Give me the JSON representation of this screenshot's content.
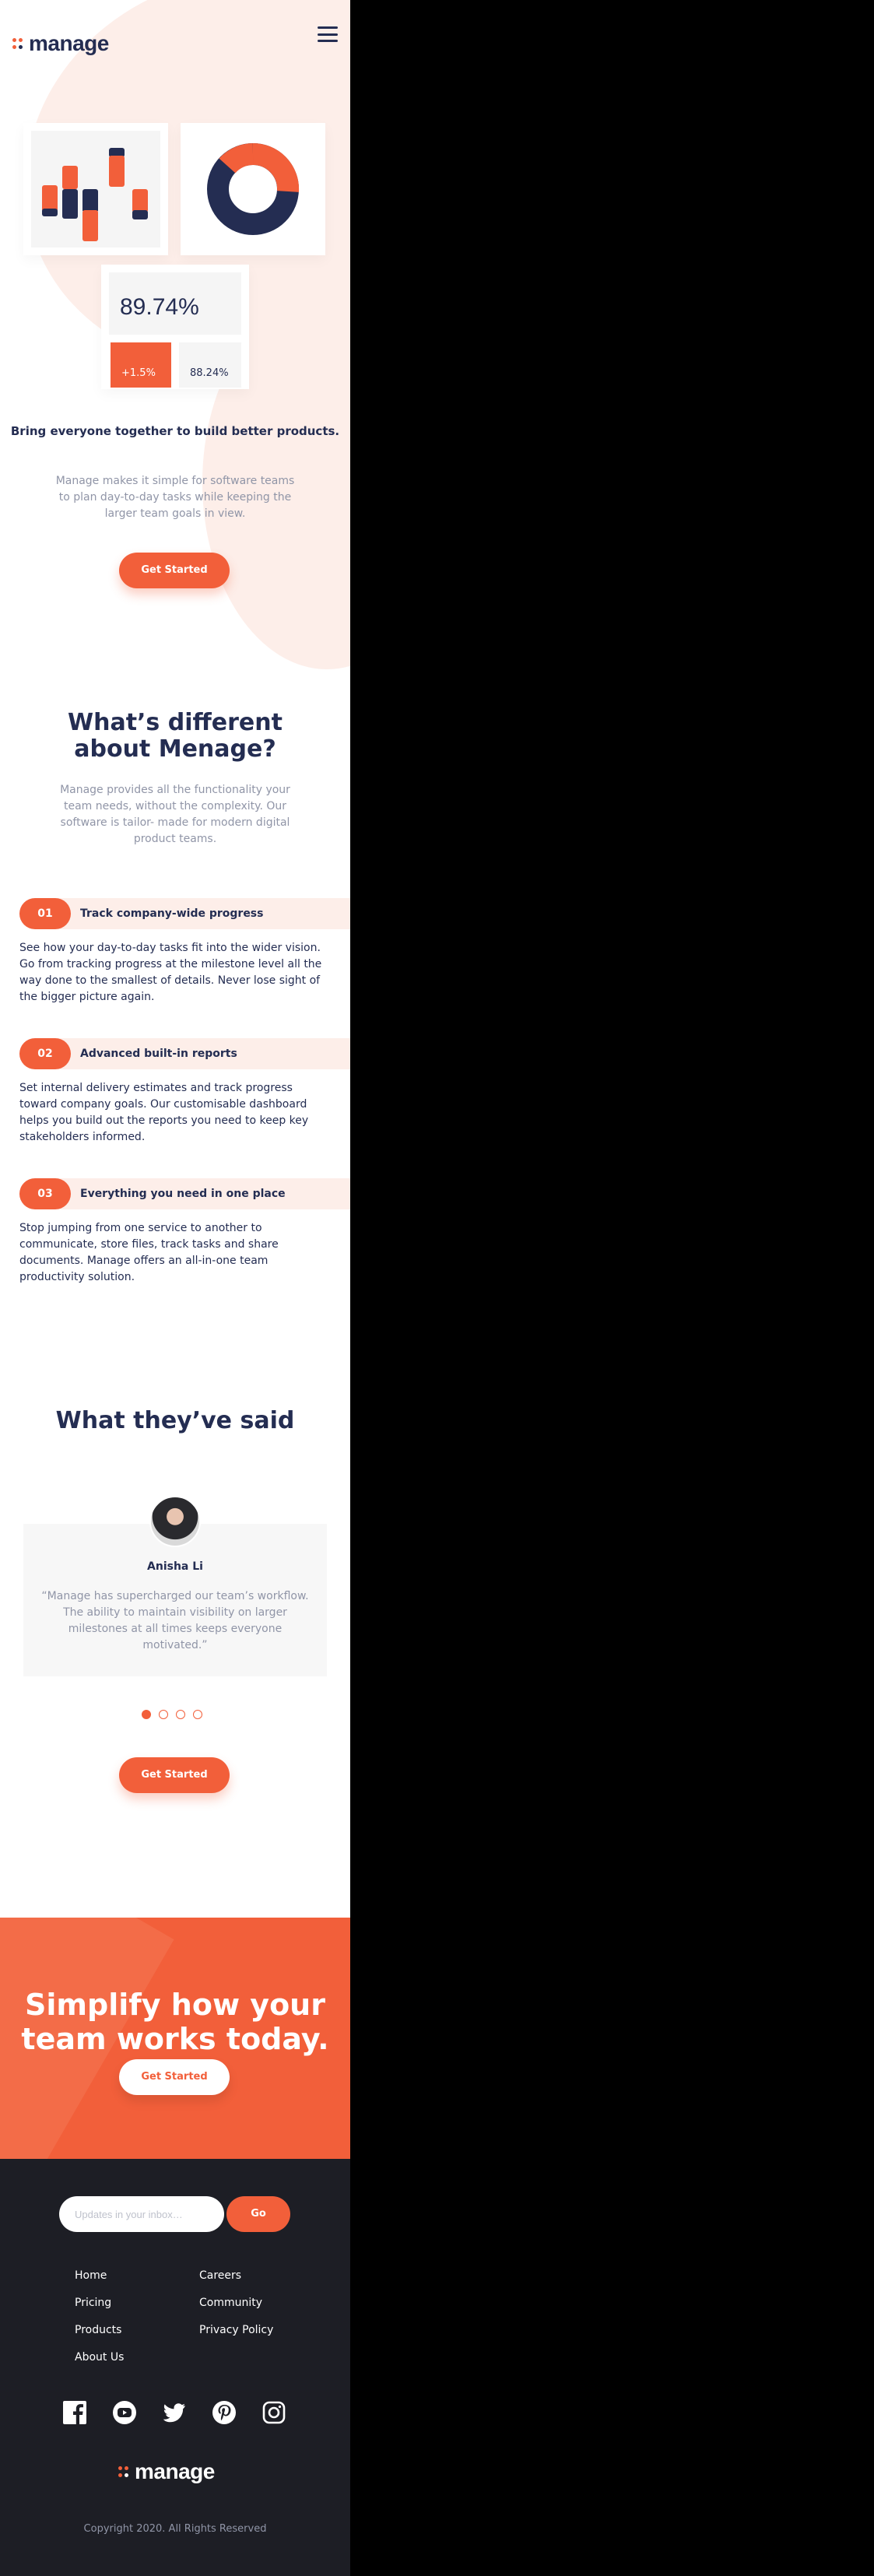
{
  "header": {
    "logo_text": "manage",
    "menu_icon": "hamburger-icon"
  },
  "hero": {
    "stat_main": "89.74%",
    "stat_change": "+1.5%",
    "stat_secondary": "88.24%",
    "title": "Bring everyone together to build better products.",
    "description": "Manage makes it simple for software teams to plan day-to-day tasks while keeping the larger team goals in view.",
    "cta_label": "Get Started"
  },
  "different": {
    "title": "What’s different about Menage?",
    "description": "Manage provides all the functionality your team needs, without the complexity. Our software is tailor- made for modern digital product teams.",
    "features": [
      {
        "number": "01",
        "title": "Track company-wide progress",
        "description": "See how your day-to-day tasks fit into the wider vision. Go from tracking progress at the milestone level all the way done to the smallest of details. Never lose sight of the bigger picture again."
      },
      {
        "number": "02",
        "title": "Advanced built-in reports",
        "description": "Set internal delivery estimates and track progress toward company goals. Our customisable dashboard helps you build out the reports you need to keep key stakeholders informed."
      },
      {
        "number": "03",
        "title": "Everything you need in one place",
        "description": "Stop jumping from one service to another to communicate, store files, track tasks and share documents. Manage offers an all-in-one team productivity solution."
      }
    ]
  },
  "testimonials": {
    "title": "What they’ve said",
    "name": "Anisha Li",
    "quote": "“Manage has supercharged our team’s workflow. The ability to maintain visibility on larger milestones at all times keeps everyone motivated.”",
    "active_slide": 1,
    "slide_count": 4,
    "cta_label": "Get Started"
  },
  "cta": {
    "title": "Simplify how your team works today.",
    "button_label": "Get Started"
  },
  "footer": {
    "input_placeholder": "Updates in your inbox…",
    "go_label": "Go",
    "links_col1": [
      "Home",
      "Pricing",
      "Products",
      "About Us"
    ],
    "links_col2": [
      "Careers",
      "Community",
      "Privacy Policy"
    ],
    "social": [
      "facebook-icon",
      "youtube-icon",
      "twitter-icon",
      "pinterest-icon",
      "instagram-icon"
    ],
    "logo_text": "manage",
    "copyright": "Copyright 2020. All Rights Reserved"
  },
  "colors": {
    "accent": "#f25f3a",
    "navy": "#242d52",
    "pale": "#fdeee9",
    "footer_bg": "#1d1e25"
  }
}
